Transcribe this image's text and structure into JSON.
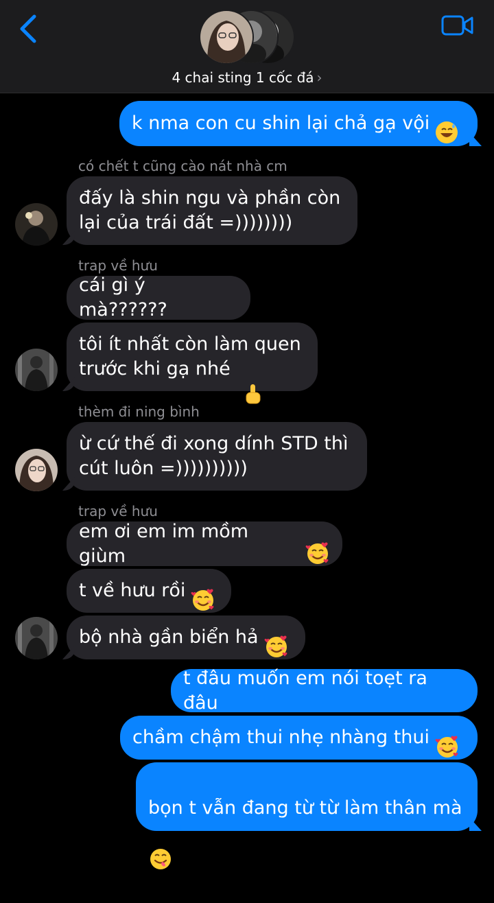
{
  "header": {
    "title": "4 chai sting 1 cốc đá",
    "chevron": "›",
    "back_icon": "chevron-left-icon",
    "video_icon": "video-camera-icon",
    "accent_color": "#0a84ff"
  },
  "messages": [
    {
      "direction": "outgoing",
      "text": "k nma con cu shin lại chả gạ vội",
      "emoji": "grinning-sweat-emoji"
    },
    {
      "direction": "incoming",
      "sender": "có chết t cũng cào nát nhà cm",
      "text": "đấy là shin ngu và phần còn\nlại của trái đất =))))))))"
    },
    {
      "direction": "incoming",
      "sender": "trap về hưu",
      "text": "cái gì ý mà??????"
    },
    {
      "direction": "incoming",
      "text": "tôi ít nhất còn làm quen\ntrước khi gạ nhé",
      "emoji": "middle-finger-emoji"
    },
    {
      "direction": "incoming",
      "sender": "thèm đi ning bình",
      "text": "ừ cứ thế đi xong dính STD thì\ncút luôn =))))))))))"
    },
    {
      "direction": "incoming",
      "sender": "trap về hưu",
      "text": "em ơi em im mồm giùm",
      "emoji": "smiling-hearts-emoji"
    },
    {
      "direction": "incoming",
      "text": "t về hưu rồi",
      "emoji": "smiling-hearts-emoji"
    },
    {
      "direction": "incoming",
      "text": "bộ nhà gần biển hả",
      "emoji": "smiling-hearts-emoji"
    },
    {
      "direction": "outgoing",
      "text": "t đâu muốn em nói toẹt ra đâu"
    },
    {
      "direction": "outgoing",
      "text": "chầm chậm thui nhẹ nhàng thui",
      "emoji": "smiling-hearts-emoji"
    },
    {
      "direction": "outgoing",
      "text": "bọn t vẫn đang từ từ làm thân mà",
      "emoji": "yum-emoji"
    }
  ]
}
